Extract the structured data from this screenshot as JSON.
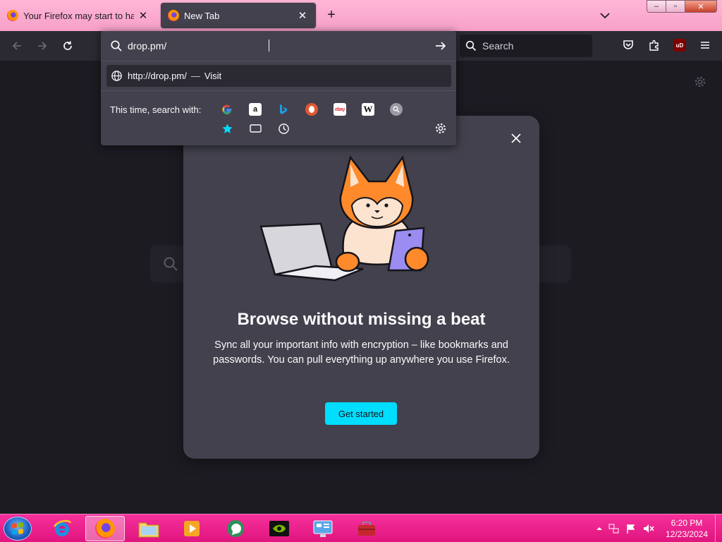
{
  "browser": {
    "tabs": [
      {
        "label": "Your Firefox may start to have p",
        "close": "✕"
      },
      {
        "label": "New Tab",
        "close": "✕"
      }
    ],
    "new_tab_symbol": "+",
    "window_controls": {
      "minimize": "–",
      "maximize": "▫",
      "close": "✕"
    }
  },
  "toolbar": {
    "search_placeholder": "Search",
    "extension_badge": "uD"
  },
  "urlbar": {
    "value": "drop.pm/",
    "result": {
      "url": "http://drop.pm/",
      "separator": "—",
      "action": "Visit"
    },
    "search_with_label": "This time, search with:",
    "engines": [
      "google",
      "amazon",
      "bing",
      "duckduckgo",
      "ebay",
      "wikipedia",
      "search"
    ],
    "engine_glyphs": {
      "amazon": "a",
      "ebay": "ebay",
      "wikipedia": "W"
    },
    "modes": [
      "bookmarks",
      "tabs",
      "history"
    ]
  },
  "modal": {
    "title": "Browse without missing a beat",
    "subtitle": "Sync all your important info with encryption – like bookmarks and passwords. You can pull everything up anywhere you use Firefox.",
    "cta": "Get started"
  },
  "taskbar": {
    "apps": [
      "internet-explorer",
      "firefox",
      "file-explorer",
      "media-player",
      "messenger",
      "nvidia",
      "control-panel",
      "toolbox"
    ],
    "active_app": "firefox",
    "clock": {
      "time": "6:20 PM",
      "date": "12/23/2024"
    }
  },
  "colors": {
    "tabstrip": "#f6a0c8",
    "toolbar": "#2b2a33",
    "content_bg": "#1c1b22",
    "modal_bg": "#42414d",
    "accent": "#00ddff",
    "taskbar": "#e0157f"
  }
}
